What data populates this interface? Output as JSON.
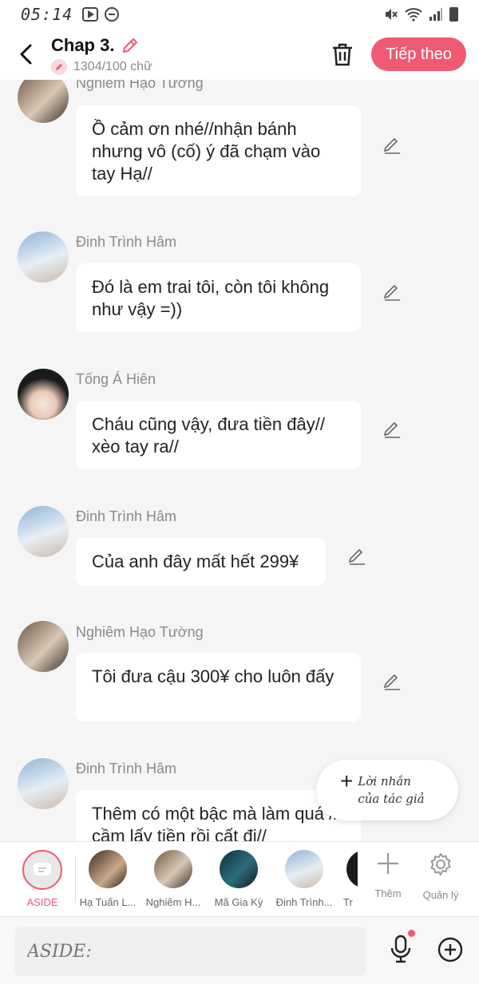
{
  "status_bar": {
    "time": "05:14"
  },
  "header": {
    "title": "Chap 3.",
    "word_count": "1304/100 chữ",
    "next_button": "Tiếp theo"
  },
  "messages": [
    {
      "sender": "Nghiêm Hạo Tường",
      "text": "Ồ cảm ơn nhé//nhận bánh nhưng vô (cố) ý đã chạm vào tay Hạ//"
    },
    {
      "sender": "Đinh Trình Hâm",
      "text": "Đó là em trai tôi, còn tôi không như vậy =))"
    },
    {
      "sender": "Tống Á Hiên",
      "text": "Cháu cũng vậy, đưa tiền đây// xèo tay ra//"
    },
    {
      "sender": "Đinh Trình Hâm",
      "text": "Của anh đây mất hết 299¥"
    },
    {
      "sender": "Nghiêm Hạo Tường",
      "text": "Tôi đưa cậu 300¥ cho luôn đấy"
    },
    {
      "sender": "Đinh Trình Hâm",
      "text": "Thêm có một bậc mà làm quá // cầm lấy tiền rồi cất đi//"
    }
  ],
  "author_note": {
    "label": "Lời nhắn của tác giả"
  },
  "character_bar": {
    "aside_label": "ASIDE",
    "characters": [
      {
        "name": "Hạ Tuấn L..."
      },
      {
        "name": "Nghiêm H..."
      },
      {
        "name": "Mã Gia Kỳ"
      },
      {
        "name": "Đinh Trình..."
      },
      {
        "name": "Tr"
      }
    ],
    "add_label": "Thêm",
    "manage_label": "Quản lý"
  },
  "input": {
    "placeholder": "ASIDE:"
  },
  "colors": {
    "accent": "#ef5a73",
    "background": "#f5f5f5",
    "bubble": "#ffffff"
  }
}
